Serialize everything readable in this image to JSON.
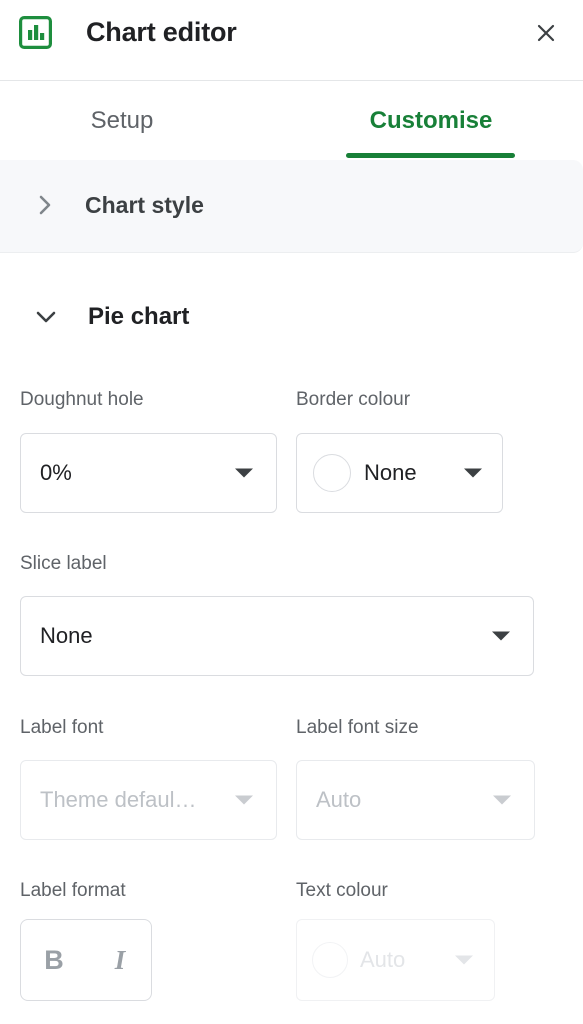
{
  "header": {
    "title": "Chart editor",
    "app_icon": "bar-chart-icon",
    "close_icon": "close-icon",
    "accent_color": "#188038"
  },
  "tabs": [
    {
      "label": "Setup",
      "selected": false
    },
    {
      "label": "Customise",
      "selected": true
    }
  ],
  "sections": [
    {
      "title": "Chart style",
      "expanded": false,
      "chevron_icon": "chevron-right-icon"
    },
    {
      "title": "Pie chart",
      "expanded": true,
      "chevron_icon": "chevron-down-icon"
    }
  ],
  "fields": {
    "doughnut_hole": {
      "label": "Doughnut hole",
      "value": "0%",
      "disabled": false
    },
    "border_colour": {
      "label": "Border colour",
      "value": "None",
      "swatch_icon": "colour-swatch-icon",
      "swatch_colour": "#ffffff",
      "disabled": false
    },
    "slice_label": {
      "label": "Slice label",
      "value": "None",
      "disabled": false
    },
    "label_font": {
      "label": "Label font",
      "value": "Theme defaul…",
      "disabled": true
    },
    "label_font_size": {
      "label": "Label font size",
      "value": "Auto",
      "disabled": true
    },
    "label_format": {
      "label": "Label format",
      "bold_label": "B",
      "italic_label": "I",
      "disabled": true
    },
    "text_colour": {
      "label": "Text colour",
      "value": "Auto",
      "swatch_icon": "colour-swatch-icon",
      "disabled": true
    }
  }
}
